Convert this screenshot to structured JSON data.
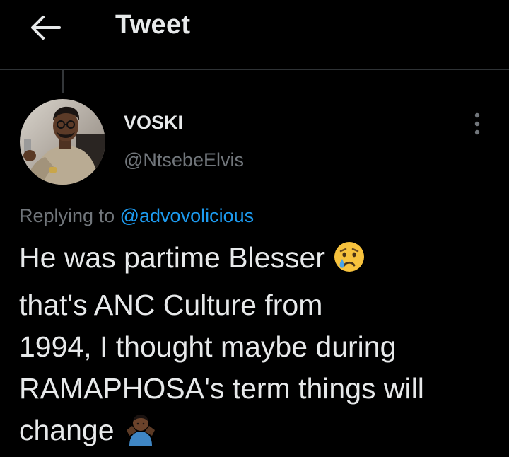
{
  "header": {
    "title": "Tweet",
    "back_icon": "arrow-left-icon"
  },
  "author": {
    "display_name": "VOSKI",
    "handle": "@NtsebeElvis",
    "avatar": "profile-photo"
  },
  "reply": {
    "prefix": "Replying to",
    "to_handle": "@advovolicious"
  },
  "tweet": {
    "lines": [
      "He was partime Blesser",
      "that's ANC Culture from",
      "1994, I thought maybe during",
      "RAMAPHOSA's term things will",
      "change"
    ],
    "emojis": [
      "crying-face-emoji",
      "shrugging-man-emoji"
    ]
  },
  "colors": {
    "background": "#000000",
    "text": "#e7e9ea",
    "secondary": "#71767b",
    "accent": "#1d9bf0",
    "divider": "#2f3336"
  }
}
